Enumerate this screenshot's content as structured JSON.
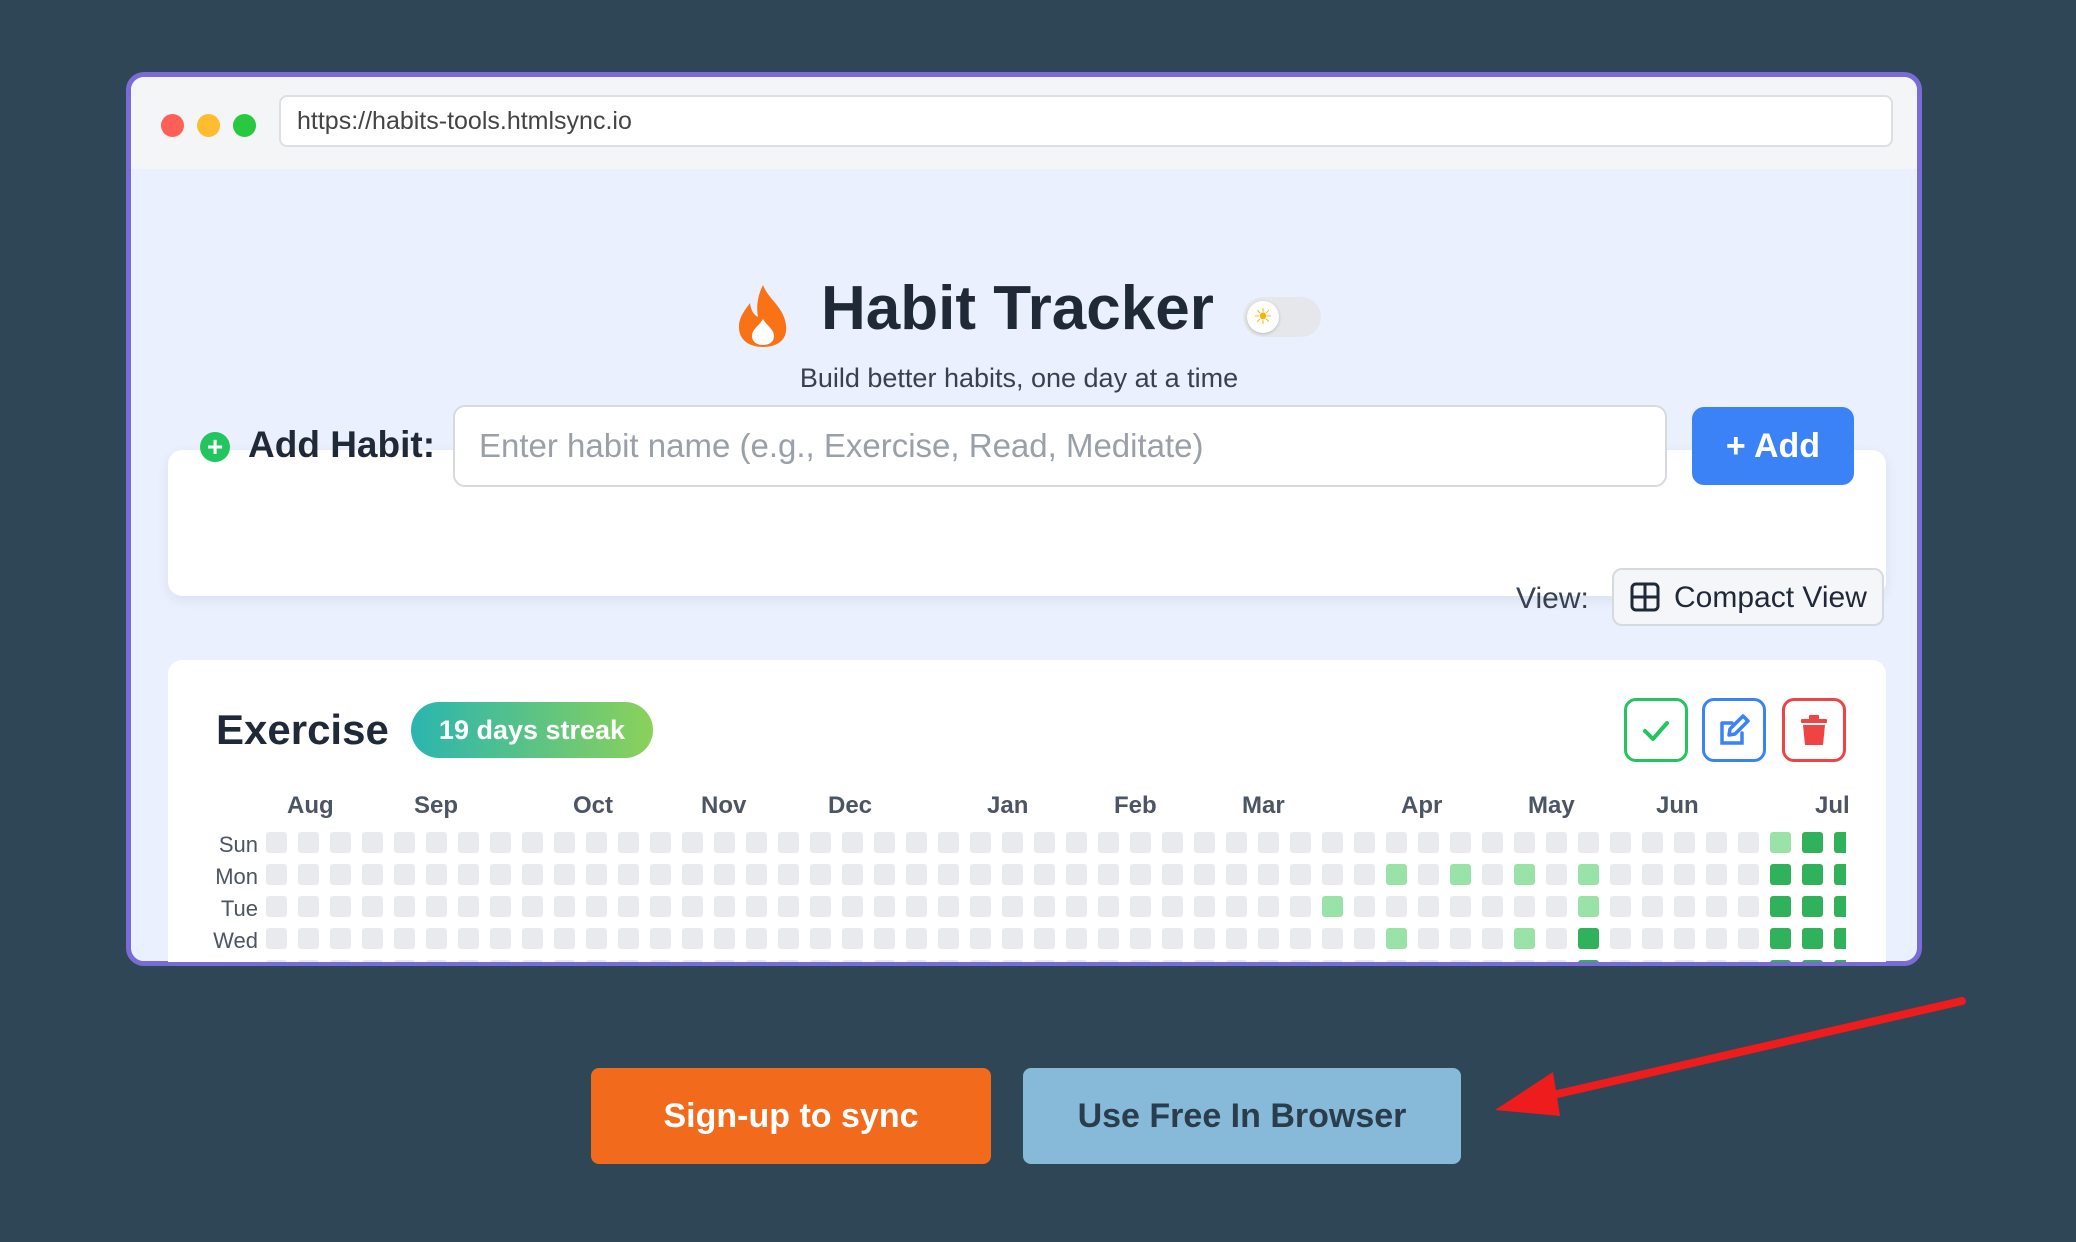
{
  "browser": {
    "url": "https://habits-tools.htmlsync.io"
  },
  "header": {
    "title": "Habit Tracker",
    "subtitle": "Build better habits, one day at a time"
  },
  "add_habit": {
    "label": "Add Habit:",
    "placeholder": "Enter habit name (e.g., Exercise, Read, Meditate)",
    "button_label": "+ Add"
  },
  "view": {
    "label": "View:",
    "button_label": "Compact View"
  },
  "habit": {
    "name": "Exercise",
    "streak": "19 days streak",
    "months": [
      "Aug",
      "Sep",
      "Oct",
      "Nov",
      "Dec",
      "Jan",
      "Feb",
      "Mar",
      "Apr",
      "May",
      "Jun",
      "Jul"
    ],
    "days": [
      "Sun",
      "Mon",
      "Tue",
      "Wed"
    ]
  },
  "cta": {
    "signup": "Sign-up to sync",
    "browser": "Use Free In Browser"
  },
  "colors": {
    "accent": "#3b82f6",
    "signup": "#f26a1b",
    "browser_btn": "#86bad8",
    "cell_empty": "#e8eaee",
    "cell_light": "#9ae3a8",
    "cell_dark": "#2fb25a",
    "arrow": "#ee1c1c"
  }
}
